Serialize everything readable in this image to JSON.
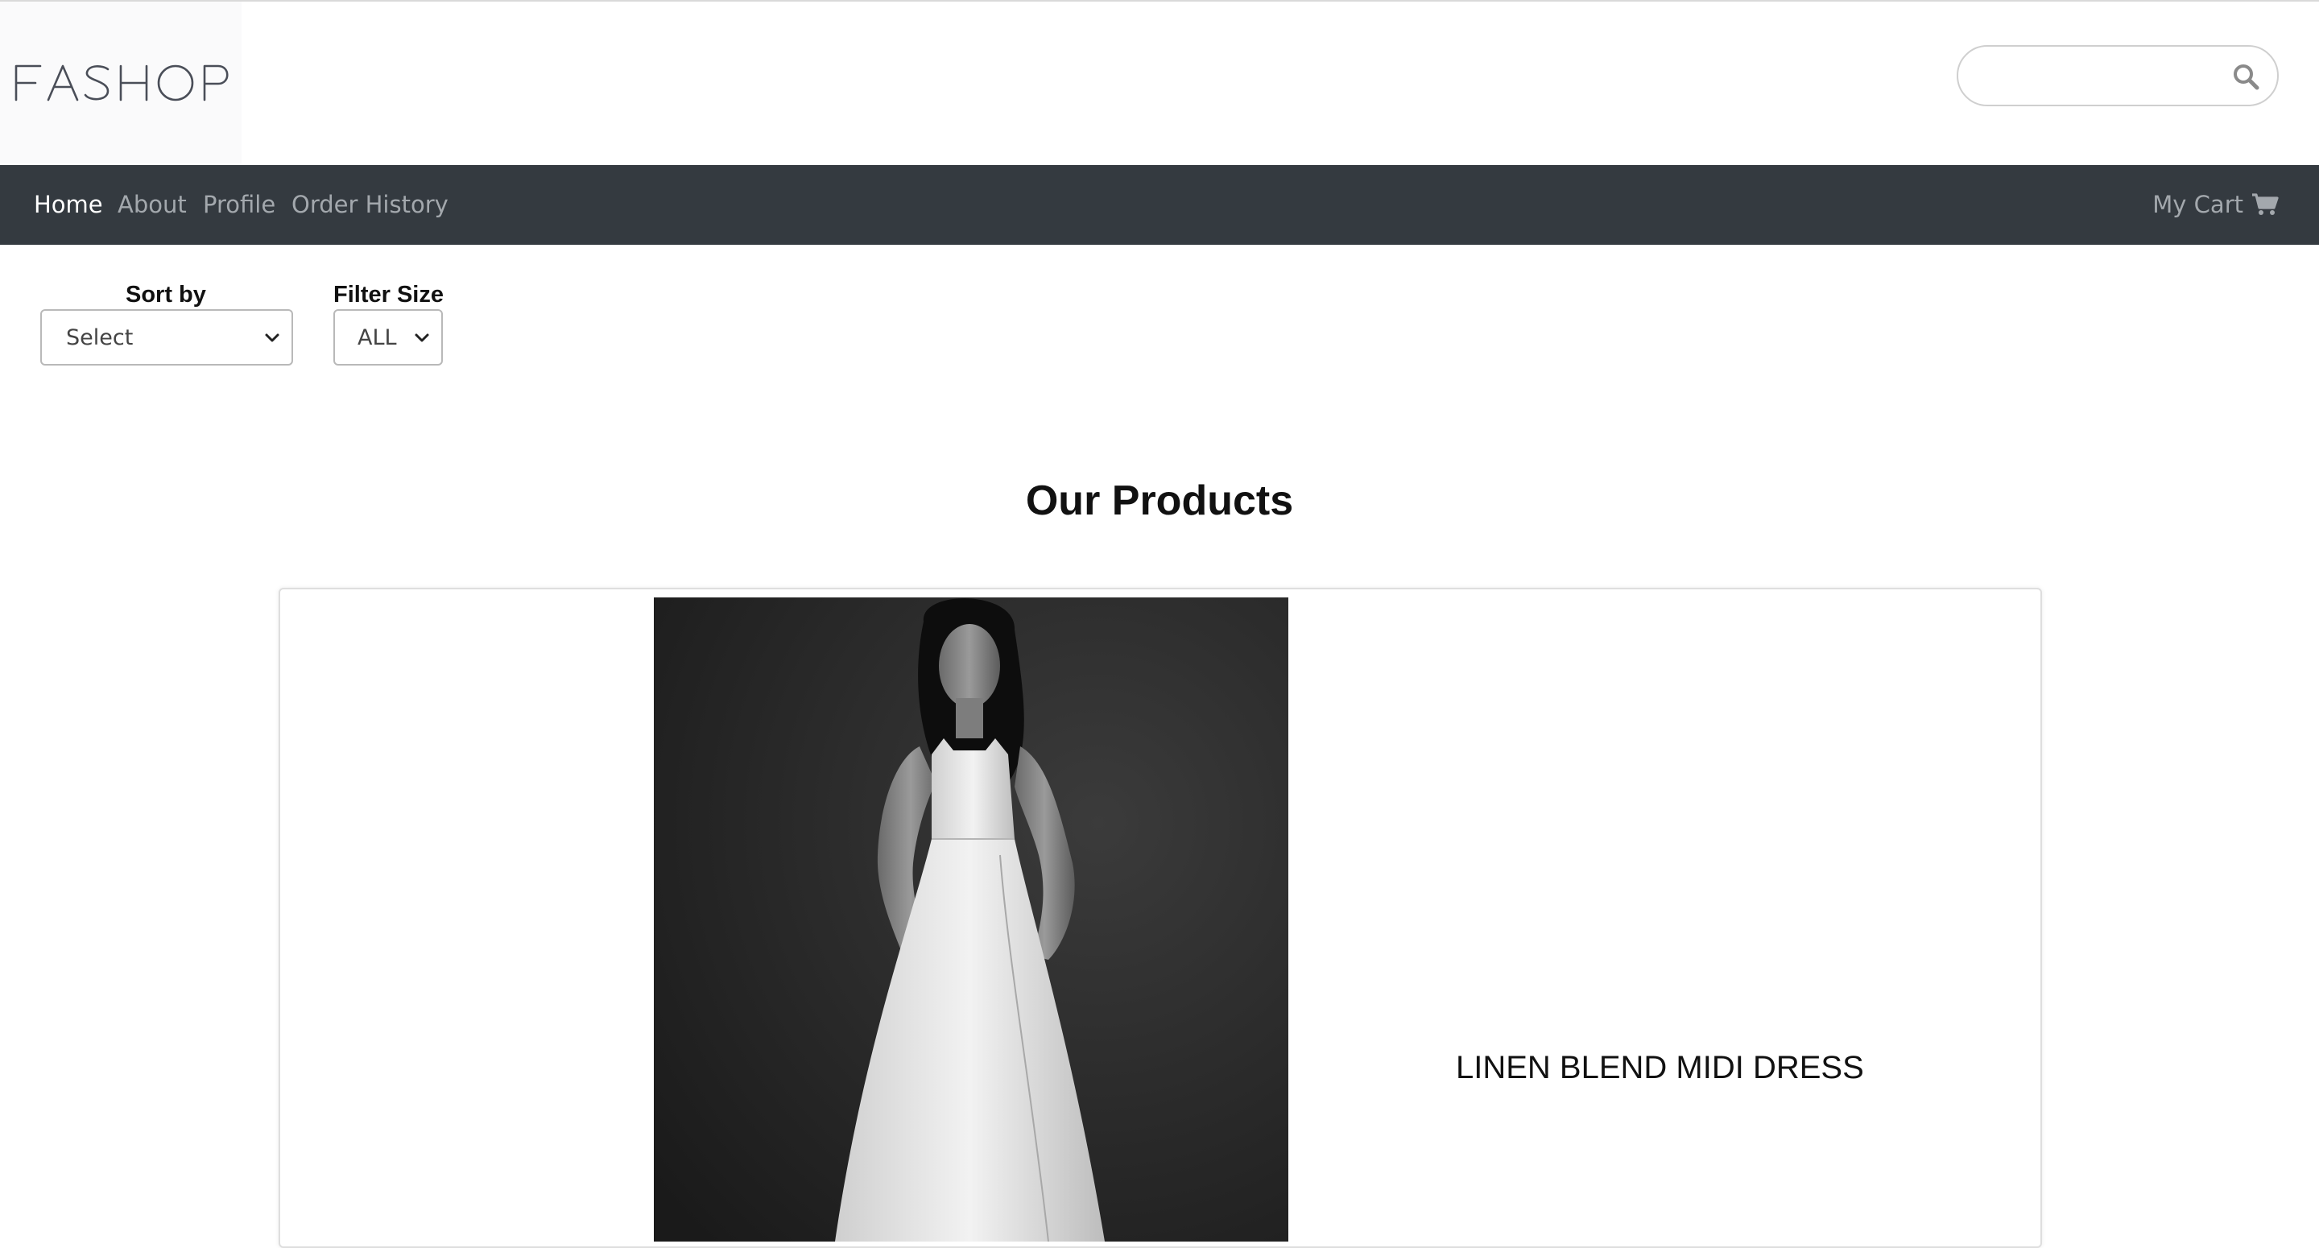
{
  "brand": {
    "logo_text": "FASHOP"
  },
  "search": {
    "placeholder": "",
    "value": ""
  },
  "nav": {
    "items": [
      {
        "label": "Home",
        "active": true
      },
      {
        "label": "About",
        "active": false
      },
      {
        "label": "Profile",
        "active": false
      },
      {
        "label": "Order History",
        "active": false
      }
    ],
    "cart_label": "My Cart"
  },
  "filters": {
    "sort": {
      "label": "Sort by",
      "selected": "Select"
    },
    "size": {
      "label": "Filter Size",
      "selected": "ALL"
    }
  },
  "main": {
    "title": "Our Products"
  },
  "products": [
    {
      "name": "LINEN BLEND MIDI DRESS"
    }
  ],
  "icons": {
    "search": "search-icon",
    "cart": "cart-icon",
    "dropdown": "chevron-down-icon"
  },
  "colors": {
    "navbar_bg": "#343a40",
    "nav_active": "#ffffff",
    "nav_inactive": "#a3a8ad"
  }
}
